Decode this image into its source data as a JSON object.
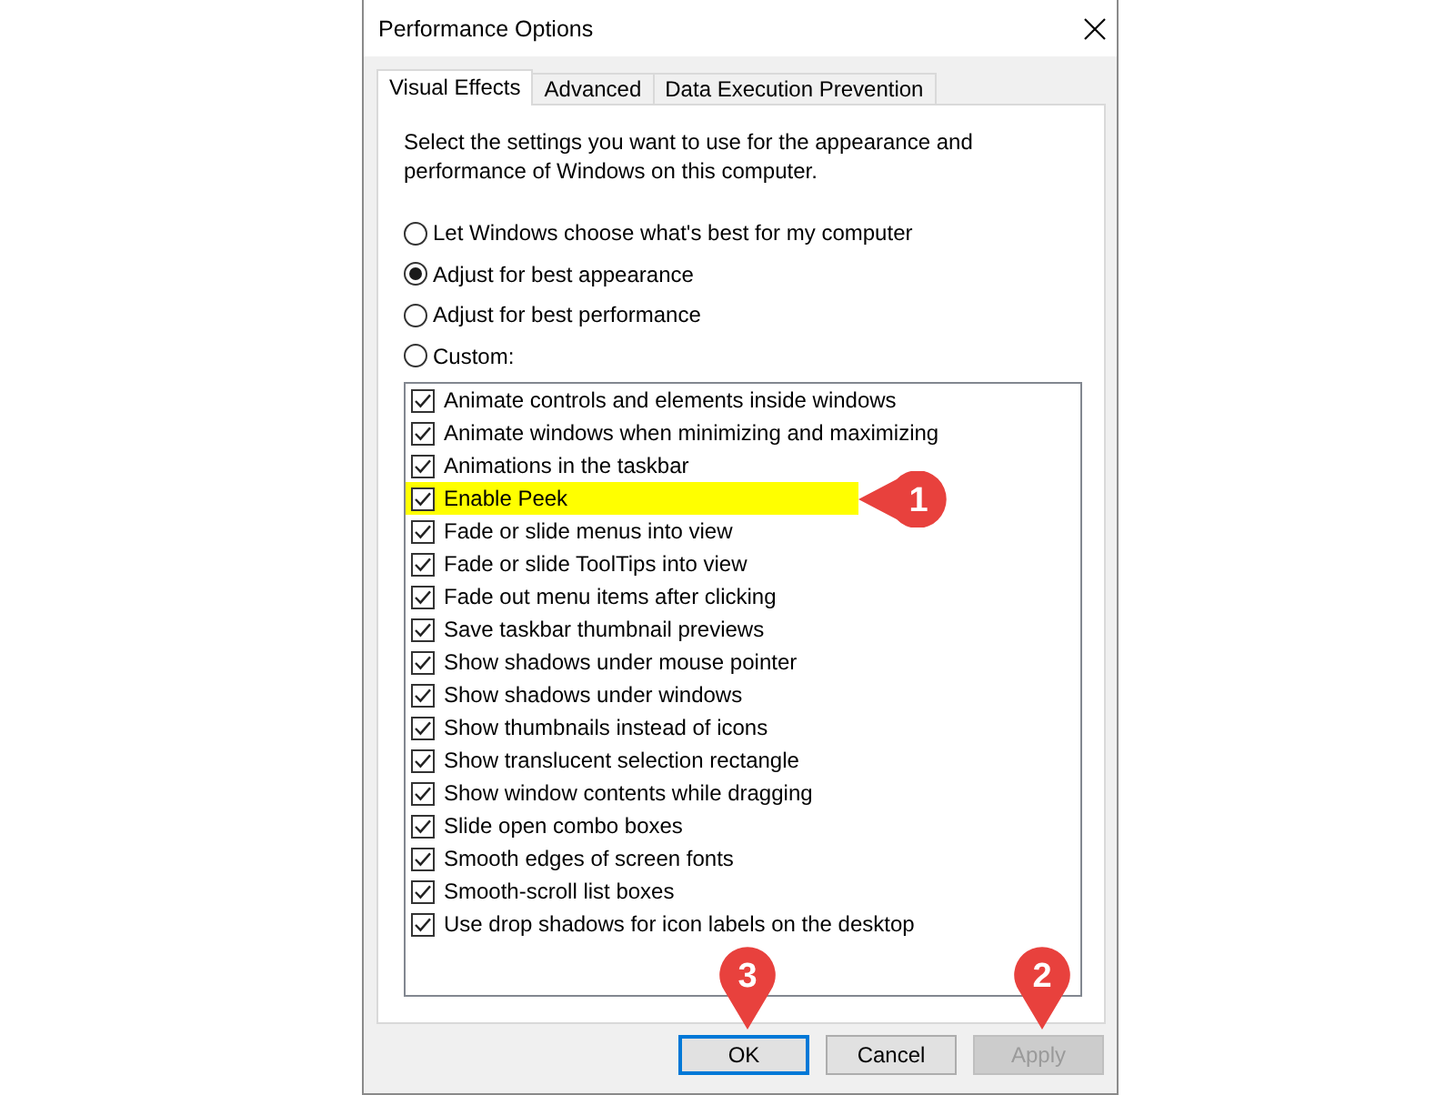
{
  "window": {
    "title": "Performance Options"
  },
  "tabs": [
    {
      "label": "Visual Effects",
      "selected": true
    },
    {
      "label": "Advanced",
      "selected": false
    },
    {
      "label": "Data Execution Prevention",
      "selected": false
    }
  ],
  "description": "Select the settings you want to use for the appearance and performance of Windows on this computer.",
  "options": [
    {
      "label": "Let Windows choose what's best for my computer",
      "selected": false
    },
    {
      "label": "Adjust for best appearance",
      "selected": true
    },
    {
      "label": "Adjust for best performance",
      "selected": false
    },
    {
      "label": "Custom:",
      "selected": false
    }
  ],
  "effects": [
    {
      "label": "Animate controls and elements inside windows",
      "checked": true,
      "highlighted": false
    },
    {
      "label": "Animate windows when minimizing and maximizing",
      "checked": true,
      "highlighted": false
    },
    {
      "label": "Animations in the taskbar",
      "checked": true,
      "highlighted": false
    },
    {
      "label": "Enable Peek",
      "checked": true,
      "highlighted": true,
      "callout": {
        "label": "1",
        "kind": "left"
      }
    },
    {
      "label": "Fade or slide menus into view",
      "checked": true,
      "highlighted": false
    },
    {
      "label": "Fade or slide ToolTips into view",
      "checked": true,
      "highlighted": false
    },
    {
      "label": "Fade out menu items after clicking",
      "checked": true,
      "highlighted": false
    },
    {
      "label": "Save taskbar thumbnail previews",
      "checked": true,
      "highlighted": false
    },
    {
      "label": "Show shadows under mouse pointer",
      "checked": true,
      "highlighted": false
    },
    {
      "label": "Show shadows under windows",
      "checked": true,
      "highlighted": false
    },
    {
      "label": "Show thumbnails instead of icons",
      "checked": true,
      "highlighted": false
    },
    {
      "label": "Show translucent selection rectangle",
      "checked": true,
      "highlighted": false
    },
    {
      "label": "Show window contents while dragging",
      "checked": true,
      "highlighted": false
    },
    {
      "label": "Slide open combo boxes",
      "checked": true,
      "highlighted": false
    },
    {
      "label": "Smooth edges of screen fonts",
      "checked": true,
      "highlighted": false
    },
    {
      "label": "Smooth-scroll list boxes",
      "checked": true,
      "highlighted": false
    },
    {
      "label": "Use drop shadows for icon labels on the desktop",
      "checked": true,
      "highlighted": false
    }
  ],
  "buttons": [
    {
      "label": "OK",
      "focused": true,
      "disabled": false,
      "callout": {
        "label": "3",
        "kind": "down"
      }
    },
    {
      "label": "Cancel",
      "focused": false,
      "disabled": false
    },
    {
      "label": "Apply",
      "focused": false,
      "disabled": true,
      "callout": {
        "label": "2",
        "kind": "down"
      }
    }
  ]
}
